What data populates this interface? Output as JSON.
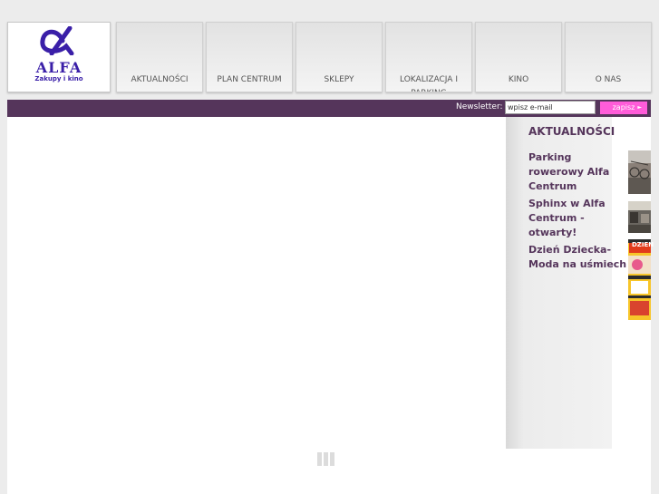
{
  "logo": {
    "name": "ALFA",
    "tagline": "Zakupy i kino",
    "color": "#3a1fa8"
  },
  "nav": {
    "items": [
      {
        "label": "AKTUALNOŚCI"
      },
      {
        "label": "PLAN CENTRUM"
      },
      {
        "label": "SKLEPY"
      },
      {
        "label": "LOKALIZACJA I PARKING"
      },
      {
        "label": "KINO"
      },
      {
        "label": "O NAS"
      }
    ]
  },
  "newsletter": {
    "label": "Newsletter:",
    "value": "wpisz e-mail",
    "button": "zapisz",
    "button_color": "#ff5cd9"
  },
  "news": {
    "title": "AKTUALNOŚCI",
    "items": [
      {
        "label": "Parking rowerowy Alfa Centrum"
      },
      {
        "label": "Sphinx w Alfa Centrum - otwarty!"
      },
      {
        "label": "Dzień Dziecka- Moda na uśmiech"
      }
    ],
    "thumb3_text": "DZIEŃ"
  },
  "colors": {
    "bar": "#55355b",
    "accent": "#55355b"
  }
}
